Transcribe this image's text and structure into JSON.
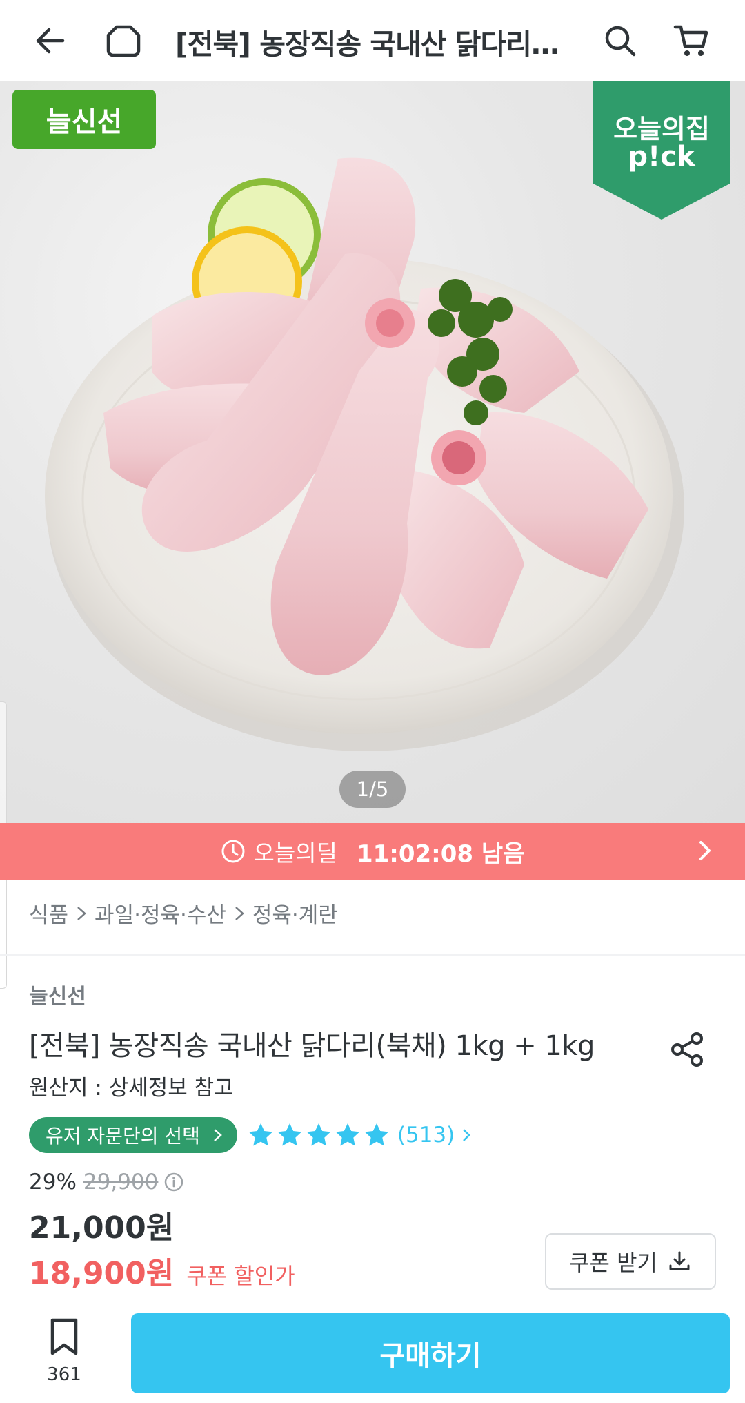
{
  "header": {
    "title": "[전북] 농장직송 국내산 닭다리(북채) 1kg + 1kg",
    "icons": [
      "back-arrow-icon",
      "home-icon",
      "search-icon",
      "cart-icon"
    ]
  },
  "hero": {
    "badge_left": "늘신선",
    "badge_pick_line1": "오늘의집",
    "badge_pick_line2": "p!ck",
    "pager": "1/5",
    "colors": {
      "badge_green": "#47a72a",
      "pick_green": "#2f9c6b"
    }
  },
  "deal": {
    "label": "오늘의딜",
    "time": "11:02:08 남음",
    "color": "#f97b7b"
  },
  "breadcrumb": [
    "식품",
    "과일·정육·수산",
    "정육·계란"
  ],
  "product": {
    "brand": "늘신선",
    "title": "[전북] 농장직송 국내산 닭다리(북채) 1kg + 1kg",
    "origin": "원산지 : 상세정보 참고",
    "badge": "유저 자문단의 선택",
    "rating_stars": 5,
    "review_count": "(513)",
    "discount_rate": "29%",
    "original_price": "29,900",
    "price": "21,000원",
    "coupon_price": "18,900원",
    "coupon_price_label": "쿠폰 할인가",
    "coupon_button": "쿠폰 받기"
  },
  "bottom": {
    "bookmark_count": "361",
    "buy_label": "구매하기",
    "accent": "#35c5f0"
  }
}
